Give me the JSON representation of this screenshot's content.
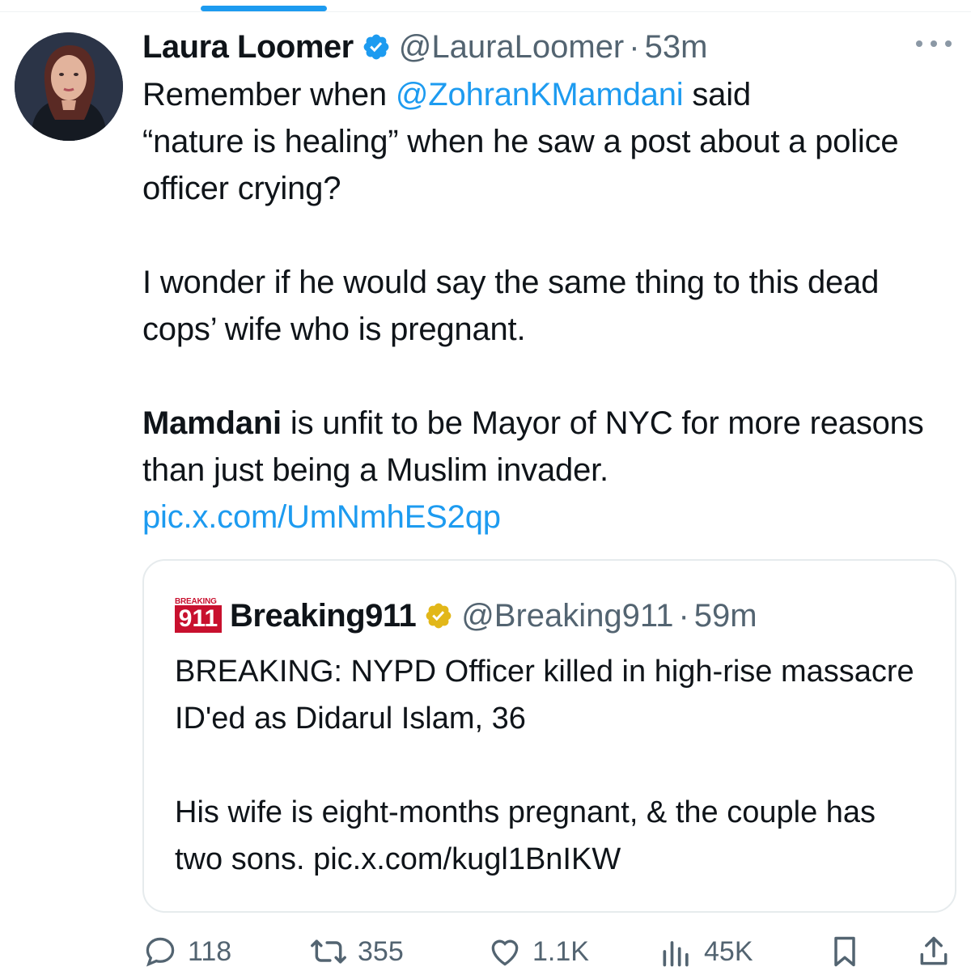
{
  "tweet": {
    "author_name": "Laura Loomer",
    "handle": "@LauraLoomer",
    "separator": "·",
    "time": "53m",
    "text": {
      "line1_prefix": "Remember when ",
      "mention": "@ZohranKMamdani",
      "line1_suffix": " said",
      "line2": "“nature is healing” when he saw a post about a police officer crying?",
      "para2": "I wonder if he would say the same thing to this dead cops’ wife who is pregnant.",
      "para3_bold": "Mamdani",
      "para3_rest": " is unfit to be Mayor of NYC for more reasons than just being a Muslim invader.",
      "link": "pic.x.com/UmNmhES2qp"
    }
  },
  "quote": {
    "logo_tag": "BREAKING",
    "logo_num": "911",
    "author_name": "Breaking911",
    "handle": "@Breaking911",
    "separator": "·",
    "time": "59m",
    "para1": "BREAKING: NYPD Officer killed in high-rise massacre ID'ed as Didarul Islam, 36",
    "para2": "His wife is eight-months pregnant, & the couple has two sons. pic.x.com/kugl1BnIKW"
  },
  "actions": {
    "replies": "118",
    "reposts": "355",
    "likes": "1.1K",
    "views": "45K"
  },
  "colors": {
    "accent": "#1d9bf0",
    "verified_blue": "#1d9bf0",
    "verified_gold": "#e2b719",
    "muted": "#536471"
  }
}
